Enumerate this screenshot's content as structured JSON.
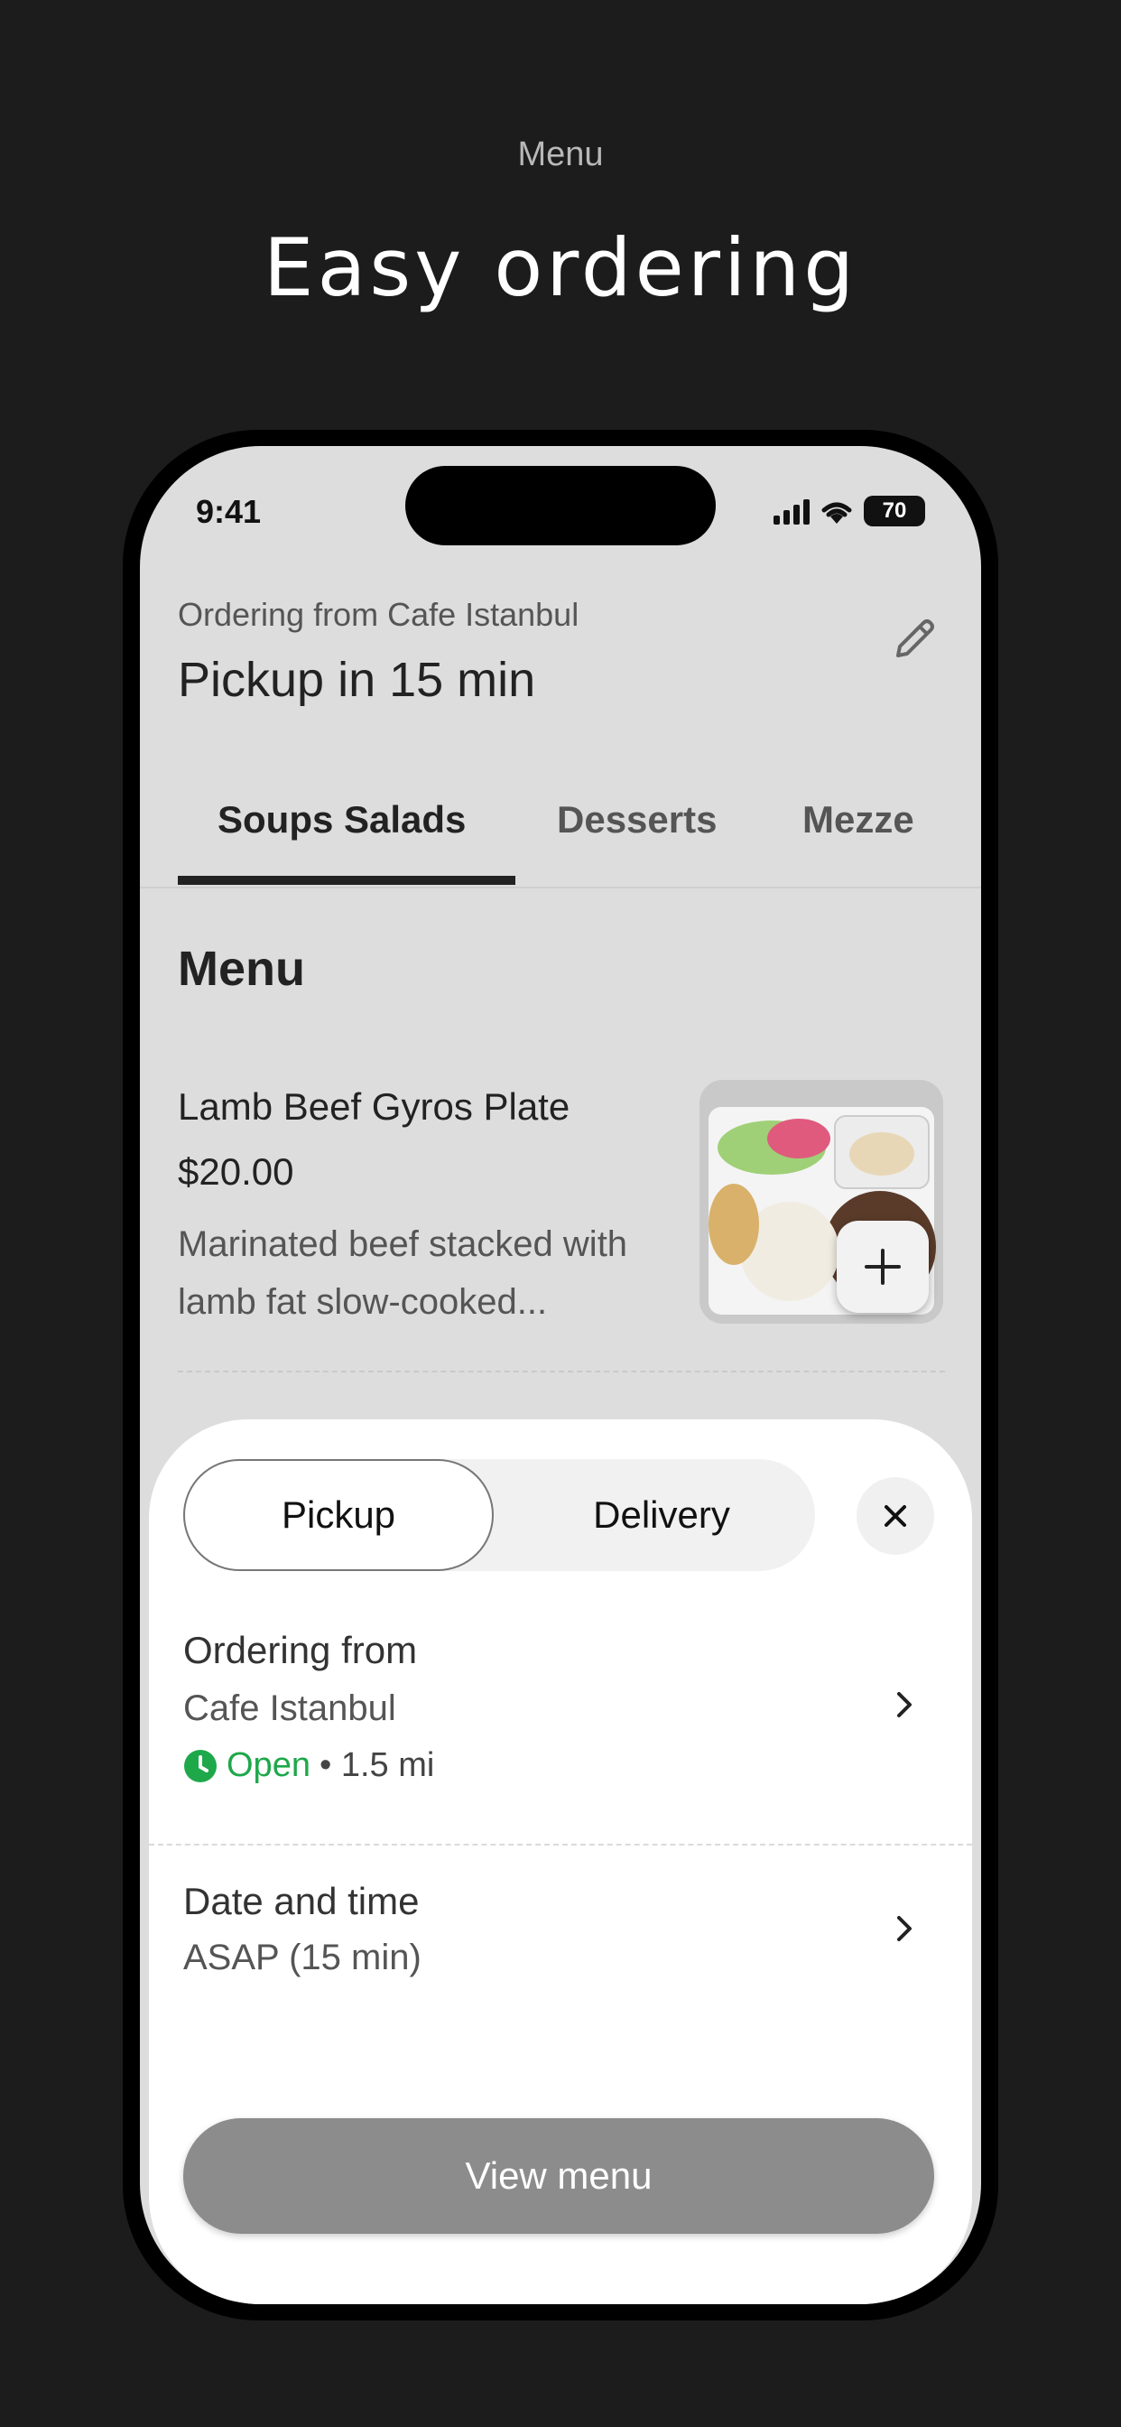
{
  "promo": {
    "subtitle": "Menu",
    "title": "Easy ordering"
  },
  "status_bar": {
    "time": "9:41",
    "battery": "70"
  },
  "header": {
    "ordering_from": "Ordering from Cafe Istanbul",
    "pickup": "Pickup in 15 min"
  },
  "tabs": [
    {
      "label": "Soups Salads",
      "active": true
    },
    {
      "label": "Desserts",
      "active": false
    },
    {
      "label": "Mezze",
      "active": false
    }
  ],
  "menu": {
    "heading": "Menu",
    "item": {
      "name": "Lamb Beef Gyros Plate",
      "price": "$20.00",
      "description": "Marinated beef stacked with lamb fat slow-cooked..."
    }
  },
  "sheet": {
    "mode": {
      "pickup": "Pickup",
      "delivery": "Delivery",
      "selected": "Pickup"
    },
    "location": {
      "title": "Ordering from",
      "value": "Cafe Istanbul",
      "status": "Open",
      "distance": "• 1.5 mi"
    },
    "datetime": {
      "title": "Date and time",
      "value": "ASAP (15 min)"
    },
    "cta": "View menu"
  },
  "colors": {
    "open_green": "#1ea84a",
    "button_gray": "#8c8c8c"
  }
}
